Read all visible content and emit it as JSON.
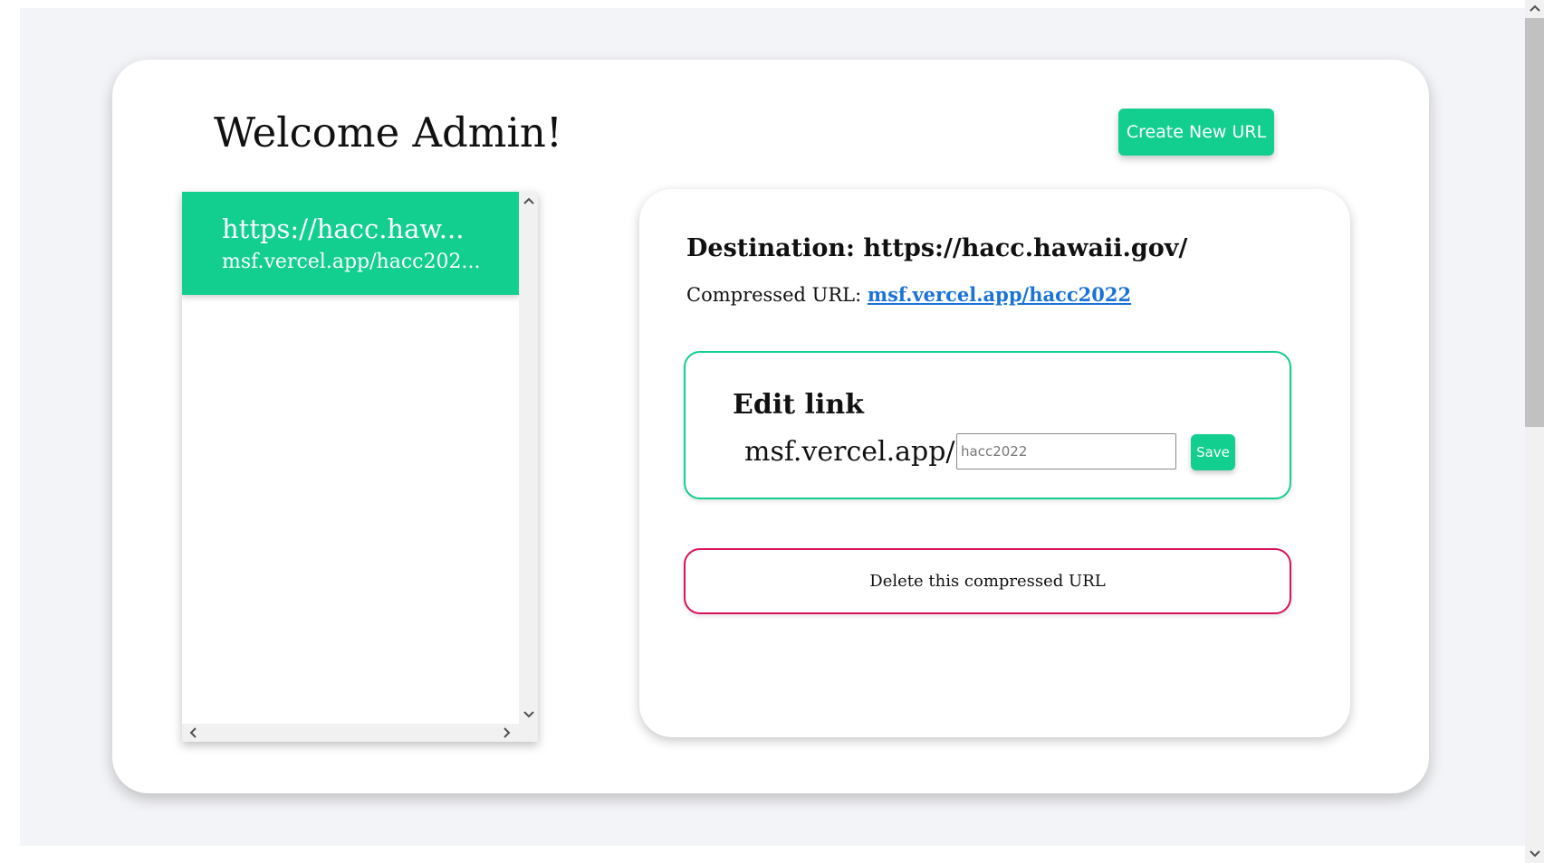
{
  "header": {
    "welcome": "Welcome Admin!",
    "create_button": "Create New URL"
  },
  "url_list": {
    "items": [
      {
        "destination": "https://hacc.haw...",
        "short_url": "msf.vercel.app/hacc202..."
      }
    ]
  },
  "detail": {
    "destination_label": "Destination: https://hacc.hawaii.gov/",
    "compressed_label": "Compressed URL: ",
    "compressed_link": "msf.vercel.app/hacc2022",
    "edit": {
      "title": "Edit link",
      "prefix": "msf.vercel.app/",
      "placeholder": "hacc2022",
      "save_label": "Save"
    },
    "delete_label": "Delete this compressed URL"
  },
  "icons": {
    "scroll_up": "chevron-up-icon",
    "scroll_down": "chevron-down-icon",
    "scroll_left": "chevron-left-icon",
    "scroll_right": "chevron-right-icon"
  },
  "colors": {
    "accent": "#12cf8f",
    "danger": "#d6135a",
    "link": "#1a73d9",
    "background": "#f3f4f7"
  }
}
